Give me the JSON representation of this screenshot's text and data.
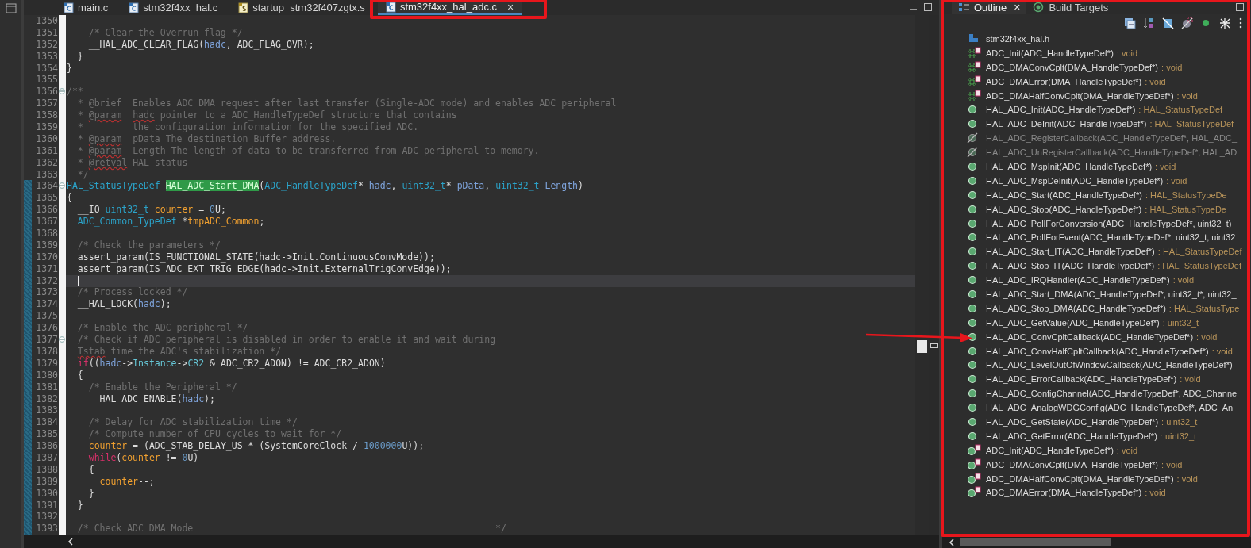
{
  "editor": {
    "tabs": [
      {
        "label": "main.c",
        "kind": "c",
        "selected": false,
        "annotated": false
      },
      {
        "label": "stm32f4xx_hal.c",
        "kind": "c",
        "selected": false,
        "annotated": false
      },
      {
        "label": "startup_stm32f407zgtx.s",
        "kind": "asm",
        "selected": false,
        "annotated": false
      },
      {
        "label": "stm32f4xx_hal_adc.c",
        "kind": "c",
        "selected": true,
        "annotated": true,
        "close": "×"
      }
    ],
    "lines": [
      {
        "number": "1350",
        "changed": false,
        "fold": false,
        "current": false
      },
      {
        "number": "1351",
        "changed": false,
        "fold": false,
        "current": false,
        "segments": [
          {
            "kind": "comment",
            "text": "    /* Clear the Overrun flag */"
          }
        ]
      },
      {
        "number": "1352",
        "changed": false,
        "fold": false,
        "current": false,
        "segments": [
          {
            "kind": "plain",
            "text": "    __HAL_ADC_CLEAR_FLAG("
          },
          {
            "kind": "param",
            "text": "hadc"
          },
          {
            "kind": "plain",
            "text": ", ADC_FLAG_OVR);"
          }
        ]
      },
      {
        "number": "1353",
        "changed": false,
        "fold": false,
        "current": false,
        "segments": [
          {
            "kind": "plain",
            "text": "  }"
          }
        ]
      },
      {
        "number": "1354",
        "changed": false,
        "fold": false,
        "current": false,
        "segments": [
          {
            "kind": "plain",
            "text": "}"
          }
        ]
      },
      {
        "number": "1355",
        "changed": false,
        "fold": false,
        "current": false
      },
      {
        "number": "1356",
        "changed": false,
        "fold": true,
        "current": false,
        "segments": [
          {
            "kind": "comment",
            "text": "/**"
          }
        ]
      },
      {
        "number": "1357",
        "changed": false,
        "fold": false,
        "current": false,
        "segments": [
          {
            "kind": "comment",
            "text": "  * @brief  Enables ADC DMA request after last transfer (Single-ADC mode) and enables ADC peripheral"
          }
        ]
      },
      {
        "number": "1358",
        "changed": false,
        "fold": false,
        "current": false,
        "segments": [
          {
            "kind": "comment",
            "text": "  * "
          },
          {
            "kind": "misspelled",
            "text": "@param"
          },
          {
            "kind": "misspelled",
            "text": "  hadc"
          },
          {
            "kind": "comment",
            "text": " pointer to a ADC_HandleTypeDef structure that contains"
          }
        ]
      },
      {
        "number": "1359",
        "changed": false,
        "fold": false,
        "current": false,
        "segments": [
          {
            "kind": "comment",
            "text": "  *         the configuration information for the specified ADC."
          }
        ]
      },
      {
        "number": "1360",
        "changed": false,
        "fold": false,
        "current": false,
        "segments": [
          {
            "kind": "comment",
            "text": "  * "
          },
          {
            "kind": "misspelled",
            "text": "@param"
          },
          {
            "kind": "comment",
            "text": "  pData The destination Buffer address."
          }
        ]
      },
      {
        "number": "1361",
        "changed": false,
        "fold": false,
        "current": false,
        "segments": [
          {
            "kind": "comment",
            "text": "  * "
          },
          {
            "kind": "misspelled",
            "text": "@param"
          },
          {
            "kind": "comment",
            "text": "  Length The length of data to be transferred from ADC peripheral to memory."
          }
        ]
      },
      {
        "number": "1362",
        "changed": false,
        "fold": false,
        "current": false,
        "segments": [
          {
            "kind": "comment",
            "text": "  * "
          },
          {
            "kind": "misspelled",
            "text": "@retval"
          },
          {
            "kind": "comment",
            "text": " HAL status"
          }
        ]
      },
      {
        "number": "1363",
        "changed": false,
        "fold": false,
        "current": false,
        "segments": [
          {
            "kind": "comment",
            "text": "  */"
          }
        ]
      },
      {
        "number": "1364",
        "changed": true,
        "fold": true,
        "current": false,
        "segments": [
          {
            "kind": "type",
            "text": "HAL_StatusTypeDef"
          },
          {
            "kind": "highlight",
            "text": " HAL_ADC_Start_DMA"
          },
          {
            "kind": "plain",
            "text": "("
          },
          {
            "kind": "type",
            "text": "ADC_HandleTypeDef"
          },
          {
            "kind": "plain",
            "text": "* "
          },
          {
            "kind": "param",
            "text": "hadc"
          },
          {
            "kind": "plain",
            "text": ", "
          },
          {
            "kind": "type",
            "text": "uint32_t"
          },
          {
            "kind": "plain",
            "text": "* "
          },
          {
            "kind": "param",
            "text": "pData"
          },
          {
            "kind": "plain",
            "text": ", "
          },
          {
            "kind": "type",
            "text": "uint32_t"
          },
          {
            "kind": "param",
            "text": " Length"
          },
          {
            "kind": "plain",
            "text": ")"
          }
        ]
      },
      {
        "number": "1365",
        "changed": true,
        "fold": false,
        "current": false,
        "segments": [
          {
            "kind": "plain",
            "text": "{"
          }
        ]
      },
      {
        "number": "1366",
        "changed": true,
        "fold": false,
        "current": false,
        "segments": [
          {
            "kind": "plain",
            "text": "  __IO "
          },
          {
            "kind": "type",
            "text": "uint32_t"
          },
          {
            "kind": "local",
            "text": " counter"
          },
          {
            "kind": "plain",
            "text": " = "
          },
          {
            "kind": "number",
            "text": "0"
          },
          {
            "kind": "plain",
            "text": "U;"
          }
        ]
      },
      {
        "number": "1367",
        "changed": true,
        "fold": false,
        "current": false,
        "segments": [
          {
            "kind": "type",
            "text": "  ADC_Common_TypeDef"
          },
          {
            "kind": "plain",
            "text": " *"
          },
          {
            "kind": "local",
            "text": "tmpADC_Common"
          },
          {
            "kind": "plain",
            "text": ";"
          }
        ]
      },
      {
        "number": "1368",
        "changed": true,
        "fold": false,
        "current": false
      },
      {
        "number": "1369",
        "changed": true,
        "fold": false,
        "current": false,
        "segments": [
          {
            "kind": "comment",
            "text": "  /* Check the parameters */"
          }
        ]
      },
      {
        "number": "1370",
        "changed": true,
        "fold": false,
        "current": false,
        "segments": [
          {
            "kind": "plain",
            "text": "  assert_param(IS_FUNCTIONAL_STATE(hadc->Init.ContinuousConvMode));"
          }
        ]
      },
      {
        "number": "1371",
        "changed": true,
        "fold": false,
        "current": false,
        "segments": [
          {
            "kind": "plain",
            "text": "  assert_param(IS_ADC_EXT_TRIG_EDGE(hadc->Init.ExternalTrigConvEdge));"
          }
        ]
      },
      {
        "number": "1372",
        "changed": true,
        "fold": false,
        "current": true
      },
      {
        "number": "1373",
        "changed": true,
        "fold": false,
        "current": false,
        "segments": [
          {
            "kind": "comment",
            "text": "  /* Process locked */"
          }
        ]
      },
      {
        "number": "1374",
        "changed": true,
        "fold": false,
        "current": false,
        "segments": [
          {
            "kind": "plain",
            "text": "  __HAL_LOCK("
          },
          {
            "kind": "param",
            "text": "hadc"
          },
          {
            "kind": "plain",
            "text": ");"
          }
        ]
      },
      {
        "number": "1375",
        "changed": true,
        "fold": false,
        "current": false
      },
      {
        "number": "1376",
        "changed": true,
        "fold": false,
        "current": false,
        "segments": [
          {
            "kind": "comment",
            "text": "  /* Enable the ADC peripheral */"
          }
        ]
      },
      {
        "number": "1377",
        "changed": true,
        "fold": true,
        "current": false,
        "segments": [
          {
            "kind": "comment",
            "text": "  /* Check if ADC peripheral is disabled in order to enable it and wait during"
          }
        ]
      },
      {
        "number": "1378",
        "changed": true,
        "fold": false,
        "current": false,
        "segments": [
          {
            "kind": "misspelled",
            "text": "  Tstab"
          },
          {
            "kind": "comment",
            "text": " time the ADC's stabilization */"
          }
        ]
      },
      {
        "number": "1379",
        "changed": true,
        "fold": false,
        "current": false,
        "segments": [
          {
            "kind": "keyword",
            "text": "  if"
          },
          {
            "kind": "plain",
            "text": "(("
          },
          {
            "kind": "param",
            "text": "hadc"
          },
          {
            "kind": "plain",
            "text": "->"
          },
          {
            "kind": "field",
            "text": "Instance"
          },
          {
            "kind": "plain",
            "text": "->"
          },
          {
            "kind": "field",
            "text": "CR2"
          },
          {
            "kind": "plain",
            "text": " & ADC_CR2_ADON) != ADC_CR2_ADON)"
          }
        ]
      },
      {
        "number": "1380",
        "changed": true,
        "fold": false,
        "current": false,
        "segments": [
          {
            "kind": "plain",
            "text": "  {"
          }
        ]
      },
      {
        "number": "1381",
        "changed": true,
        "fold": false,
        "current": false,
        "segments": [
          {
            "kind": "comment",
            "text": "    /* Enable the Peripheral */"
          }
        ]
      },
      {
        "number": "1382",
        "changed": true,
        "fold": false,
        "current": false,
        "segments": [
          {
            "kind": "plain",
            "text": "    __HAL_ADC_ENABLE("
          },
          {
            "kind": "param",
            "text": "hadc"
          },
          {
            "kind": "plain",
            "text": ");"
          }
        ]
      },
      {
        "number": "1383",
        "changed": true,
        "fold": false,
        "current": false
      },
      {
        "number": "1384",
        "changed": true,
        "fold": false,
        "current": false,
        "segments": [
          {
            "kind": "comment",
            "text": "    /* Delay for ADC stabilization time */"
          }
        ]
      },
      {
        "number": "1385",
        "changed": true,
        "fold": false,
        "current": false,
        "segments": [
          {
            "kind": "comment",
            "text": "    /* Compute number of CPU cycles to wait for */"
          }
        ]
      },
      {
        "number": "1386",
        "changed": true,
        "fold": false,
        "current": false,
        "segments": [
          {
            "kind": "local",
            "text": "    counter"
          },
          {
            "kind": "plain",
            "text": " = (ADC_STAB_DELAY_US * (SystemCoreClock / "
          },
          {
            "kind": "number",
            "text": "1000000"
          },
          {
            "kind": "plain",
            "text": "U));"
          }
        ]
      },
      {
        "number": "1387",
        "changed": true,
        "fold": false,
        "current": false,
        "segments": [
          {
            "kind": "keyword",
            "text": "    while"
          },
          {
            "kind": "plain",
            "text": "("
          },
          {
            "kind": "local",
            "text": "counter"
          },
          {
            "kind": "plain",
            "text": " != "
          },
          {
            "kind": "number",
            "text": "0"
          },
          {
            "kind": "plain",
            "text": "U)"
          }
        ]
      },
      {
        "number": "1388",
        "changed": true,
        "fold": false,
        "current": false,
        "segments": [
          {
            "kind": "plain",
            "text": "    {"
          }
        ]
      },
      {
        "number": "1389",
        "changed": true,
        "fold": false,
        "current": false,
        "segments": [
          {
            "kind": "local",
            "text": "      counter"
          },
          {
            "kind": "plain",
            "text": "--;"
          }
        ]
      },
      {
        "number": "1390",
        "changed": true,
        "fold": false,
        "current": false,
        "segments": [
          {
            "kind": "plain",
            "text": "    }"
          }
        ]
      },
      {
        "number": "1391",
        "changed": true,
        "fold": false,
        "current": false,
        "segments": [
          {
            "kind": "plain",
            "text": "  }"
          }
        ]
      },
      {
        "number": "1392",
        "changed": true,
        "fold": false,
        "current": false
      },
      {
        "number": "1393",
        "changed": true,
        "fold": false,
        "current": false,
        "segments": [
          {
            "kind": "comment",
            "text": "  /* Check ADC DMA Mode                                                       */"
          }
        ]
      }
    ]
  },
  "outline": {
    "annotated": true,
    "tabs": [
      {
        "label": "Outline",
        "kind": "outline",
        "selected": true,
        "close": "×"
      },
      {
        "label": "Build Targets",
        "kind": "targets",
        "selected": false
      }
    ],
    "items": [
      {
        "kind": "include",
        "name": "stm32f4xx_hal.h",
        "arrow": false
      },
      {
        "kind": "static-hash",
        "name": "ADC_Init(ADC_HandleTypeDef*)",
        "returns": ": void",
        "arrow": false
      },
      {
        "kind": "static-hash",
        "name": "ADC_DMAConvCplt(DMA_HandleTypeDef*)",
        "returns": ": void",
        "arrow": false
      },
      {
        "kind": "static-hash",
        "name": "ADC_DMAError(DMA_HandleTypeDef*)",
        "returns": ": void",
        "arrow": false
      },
      {
        "kind": "static-hash",
        "name": "ADC_DMAHalfConvCplt(DMA_HandleTypeDef*)",
        "returns": ": void",
        "arrow": false
      },
      {
        "kind": "function",
        "name": "HAL_ADC_Init(ADC_HandleTypeDef*)",
        "returns": ": HAL_StatusTypeDef",
        "arrow": false
      },
      {
        "kind": "function",
        "name": "HAL_ADC_DeInit(ADC_HandleTypeDef*)",
        "returns": ": HAL_StatusTypeDef",
        "arrow": false
      },
      {
        "kind": "function-disabled",
        "name": "HAL_ADC_RegisterCallback(ADC_HandleTypeDef*, HAL_ADC_",
        "arrow": false
      },
      {
        "kind": "function-disabled",
        "name": "HAL_ADC_UnRegisterCallback(ADC_HandleTypeDef*, HAL_AD",
        "arrow": false
      },
      {
        "kind": "function",
        "name": "HAL_ADC_MspInit(ADC_HandleTypeDef*)",
        "returns": ": void",
        "arrow": false
      },
      {
        "kind": "function",
        "name": "HAL_ADC_MspDeInit(ADC_HandleTypeDef*)",
        "returns": ": void",
        "arrow": false
      },
      {
        "kind": "function",
        "name": "HAL_ADC_Start(ADC_HandleTypeDef*)",
        "returns": ": HAL_StatusTypeDe",
        "arrow": false
      },
      {
        "kind": "function",
        "name": "HAL_ADC_Stop(ADC_HandleTypeDef*)",
        "returns": ": HAL_StatusTypeDe",
        "arrow": false
      },
      {
        "kind": "function",
        "name": "HAL_ADC_PollForConversion(ADC_HandleTypeDef*, uint32_t)",
        "arrow": false
      },
      {
        "kind": "function",
        "name": "HAL_ADC_PollForEvent(ADC_HandleTypeDef*, uint32_t, uint32",
        "arrow": false
      },
      {
        "kind": "function",
        "name": "HAL_ADC_Start_IT(ADC_HandleTypeDef*)",
        "returns": ": HAL_StatusTypeDef",
        "arrow": false
      },
      {
        "kind": "function",
        "name": "HAL_ADC_Stop_IT(ADC_HandleTypeDef*)",
        "returns": ": HAL_StatusTypeDef",
        "arrow": false
      },
      {
        "kind": "function",
        "name": "HAL_ADC_IRQHandler(ADC_HandleTypeDef*)",
        "returns": ": void",
        "arrow": false
      },
      {
        "kind": "function",
        "name": "HAL_ADC_Start_DMA(ADC_HandleTypeDef*, uint32_t*, uint32_",
        "arrow": false
      },
      {
        "kind": "function",
        "name": "HAL_ADC_Stop_DMA(ADC_HandleTypeDef*)",
        "returns": ": HAL_StatusType",
        "arrow": false
      },
      {
        "kind": "function",
        "name": "HAL_ADC_GetValue(ADC_HandleTypeDef*)",
        "returns": ": uint32_t",
        "arrow": false
      },
      {
        "kind": "function",
        "name": "HAL_ADC_ConvCpltCallback(ADC_HandleTypeDef*)",
        "returns": ": void",
        "arrow": true
      },
      {
        "kind": "function",
        "name": "HAL_ADC_ConvHalfCpltCallback(ADC_HandleTypeDef*)",
        "returns": ": void",
        "arrow": false
      },
      {
        "kind": "function",
        "name": "HAL_ADC_LevelOutOfWindowCallback(ADC_HandleTypeDef*)",
        "arrow": false
      },
      {
        "kind": "function",
        "name": "HAL_ADC_ErrorCallback(ADC_HandleTypeDef*)",
        "returns": ": void",
        "arrow": false
      },
      {
        "kind": "function",
        "name": "HAL_ADC_ConfigChannel(ADC_HandleTypeDef*, ADC_Channe",
        "arrow": false
      },
      {
        "kind": "function",
        "name": "HAL_ADC_AnalogWDGConfig(ADC_HandleTypeDef*, ADC_An",
        "arrow": false
      },
      {
        "kind": "function",
        "name": "HAL_ADC_GetState(ADC_HandleTypeDef*)",
        "returns": ": uint32_t",
        "arrow": false
      },
      {
        "kind": "function",
        "name": "HAL_ADC_GetError(ADC_HandleTypeDef*)",
        "returns": ": uint32_t",
        "arrow": false
      },
      {
        "kind": "static-circle",
        "name": "ADC_Init(ADC_HandleTypeDef*)",
        "returns": ": void",
        "arrow": false
      },
      {
        "kind": "static-circle",
        "name": "ADC_DMAConvCplt(DMA_HandleTypeDef*)",
        "returns": ": void",
        "arrow": false
      },
      {
        "kind": "static-circle",
        "name": "ADC_DMAHalfConvCplt(DMA_HandleTypeDef*)",
        "returns": ": void",
        "arrow": false
      },
      {
        "kind": "static-circle",
        "name": "ADC_DMAError(DMA_HandleTypeDef*)",
        "returns": ": void",
        "arrow": false
      }
    ]
  }
}
